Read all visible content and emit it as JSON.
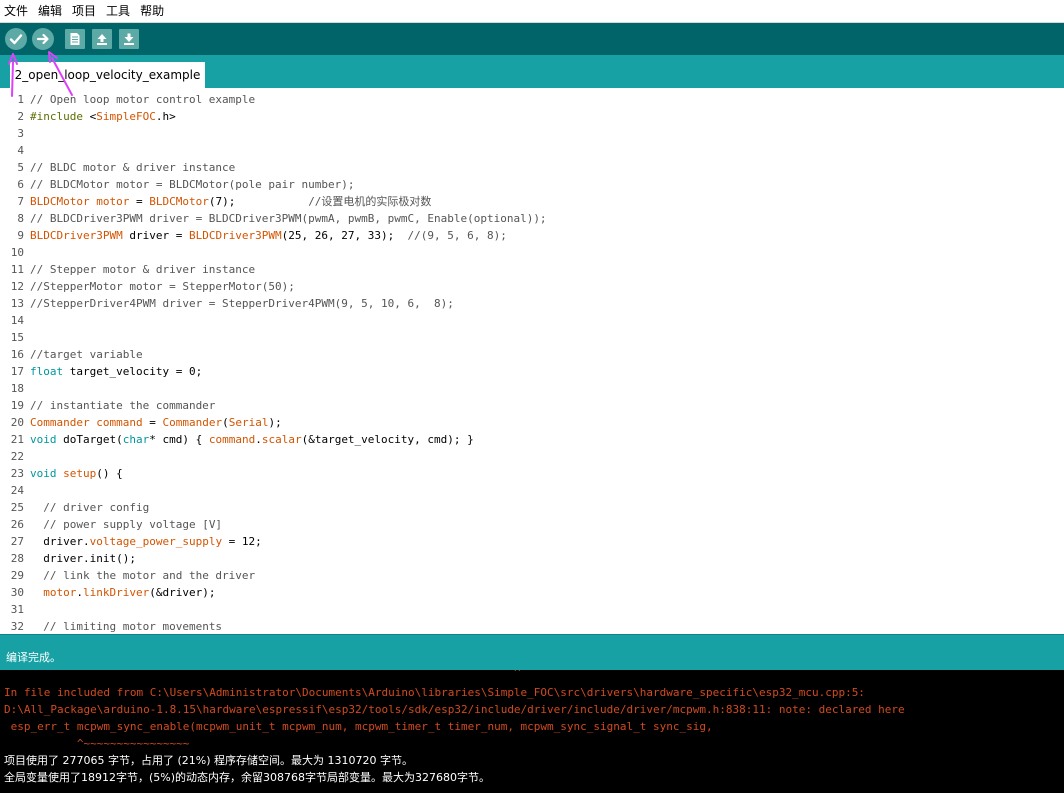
{
  "menu": [
    "文件",
    "编辑",
    "项目",
    "工具",
    "帮助"
  ],
  "toolbar": {
    "buttons": [
      {
        "name": "verify-button",
        "icon": "check-icon"
      },
      {
        "name": "upload-button",
        "icon": "arrow-right-icon"
      },
      {
        "name": "new-button",
        "icon": "file-icon"
      },
      {
        "name": "open-button",
        "icon": "arrow-up-icon"
      },
      {
        "name": "save-button",
        "icon": "arrow-down-icon"
      }
    ]
  },
  "tab": {
    "label": "2_open_loop_velocity_example"
  },
  "code_lines": [
    {
      "n": "1",
      "text": "// Open loop motor control example"
    },
    {
      "n": "2",
      "text": "#include <SimpleFOC.h>"
    },
    {
      "n": "3",
      "text": ""
    },
    {
      "n": "4",
      "text": ""
    },
    {
      "n": "5",
      "text": "// BLDC motor & driver instance"
    },
    {
      "n": "6",
      "text": "// BLDCMotor motor = BLDCMotor(pole pair number);"
    },
    {
      "n": "7",
      "text": "BLDCMotor motor = BLDCMotor(7);           //设置电机的实际极对数"
    },
    {
      "n": "8",
      "text": "// BLDCDriver3PWM driver = BLDCDriver3PWM(pwmA, pwmB, pwmC, Enable(optional));"
    },
    {
      "n": "9",
      "text": "BLDCDriver3PWM driver = BLDCDriver3PWM(25, 26, 27, 33);  //(9, 5, 6, 8);"
    },
    {
      "n": "10",
      "text": ""
    },
    {
      "n": "11",
      "text": "// Stepper motor & driver instance"
    },
    {
      "n": "12",
      "text": "//StepperMotor motor = StepperMotor(50);"
    },
    {
      "n": "13",
      "text": "//StepperDriver4PWM driver = StepperDriver4PWM(9, 5, 10, 6,  8);"
    },
    {
      "n": "14",
      "text": ""
    },
    {
      "n": "15",
      "text": ""
    },
    {
      "n": "16",
      "text": "//target variable"
    },
    {
      "n": "17",
      "text": "float target_velocity = 0;"
    },
    {
      "n": "18",
      "text": ""
    },
    {
      "n": "19",
      "text": "// instantiate the commander"
    },
    {
      "n": "20",
      "text": "Commander command = Commander(Serial);"
    },
    {
      "n": "21",
      "text": "void doTarget(char* cmd) { command.scalar(&target_velocity, cmd); }"
    },
    {
      "n": "22",
      "text": ""
    },
    {
      "n": "23",
      "text": "void setup() {"
    },
    {
      "n": "24",
      "text": ""
    },
    {
      "n": "25",
      "text": "  // driver config"
    },
    {
      "n": "26",
      "text": "  // power supply voltage [V]"
    },
    {
      "n": "27",
      "text": "  driver.voltage_power_supply = 12;"
    },
    {
      "n": "28",
      "text": "  driver.init();"
    },
    {
      "n": "29",
      "text": "  // link the motor and the driver"
    },
    {
      "n": "30",
      "text": "  motor.linkDriver(&driver);"
    },
    {
      "n": "31",
      "text": ""
    },
    {
      "n": "32",
      "text": "  // limiting motor movements"
    }
  ],
  "status": {
    "text": "编译完成。"
  },
  "console": {
    "caret_top": "^",
    "line1": "In file included from C:\\Users\\Administrator\\Documents\\Arduino\\libraries\\Simple_FOC\\src\\drivers\\hardware_specific\\esp32_mcu.cpp:5:",
    "line2": "D:\\All_Package\\arduino-1.8.15\\hardware\\espressif\\esp32/tools/sdk/esp32/include/driver/include/driver/mcpwm.h:838:11: note: declared here",
    "line3": " esp_err_t mcpwm_sync_enable(mcpwm_unit_t mcpwm_num, mcpwm_timer_t timer_num, mcpwm_sync_signal_t sync_sig,",
    "line4": "           ^~~~~~~~~~~~~~~~~",
    "line5": "项目使用了 277065 字节，占用了 (21%) 程序存储空间。最大为 1310720 字节。",
    "line6": "全局变量使用了18912字节，(5%)的动态内存，余留308768字节局部变量。最大为327680字节。"
  },
  "colors": {
    "toolbar": "#006468",
    "tabbar": "#17a1a5",
    "annotation": "#e040fb"
  }
}
